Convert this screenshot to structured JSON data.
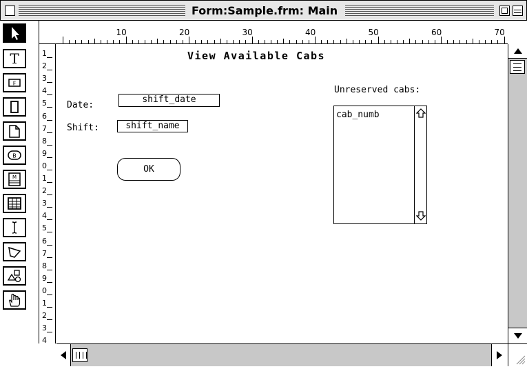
{
  "window": {
    "title": "Form:Sample.frm: Main"
  },
  "toolbar": {
    "tools": [
      {
        "icon": "arrow-pointer-icon",
        "selected": true
      },
      {
        "icon": "text-tool-icon",
        "glyph": "T"
      },
      {
        "icon": "field-tool-icon",
        "glyph": "F"
      },
      {
        "icon": "rectangle-tool-icon"
      },
      {
        "icon": "page-tool-icon"
      },
      {
        "icon": "button-tool-icon",
        "glyph": "B"
      },
      {
        "icon": "menu-tool-icon",
        "glyph": "M"
      },
      {
        "icon": "table-tool-icon"
      },
      {
        "icon": "ibeam-tool-icon"
      },
      {
        "icon": "polygon-tool-icon"
      },
      {
        "icon": "shapes-tool-icon"
      },
      {
        "icon": "hand-tool-icon"
      }
    ]
  },
  "ruler": {
    "horizontal_labels": [
      "10",
      "20",
      "30",
      "40",
      "50",
      "60",
      "70"
    ],
    "vertical_labels": [
      "1",
      "2",
      "3",
      "4",
      "5",
      "6",
      "7",
      "8",
      "9",
      "0",
      "1",
      "2",
      "3",
      "4",
      "5",
      "6",
      "7",
      "8",
      "9",
      "0",
      "1",
      "2",
      "3",
      "4"
    ]
  },
  "form": {
    "title": "View Available Cabs",
    "date_label": "Date:",
    "date_field": "shift_date",
    "shift_label": "Shift:",
    "shift_field": "shift_name",
    "ok_button": "OK",
    "unreserved_label": "Unreserved cabs:",
    "cab_list_item": "cab_numb"
  },
  "colors": {
    "titlebar_bg": "#e6e6e6",
    "scroll_track": "#c8c8c8"
  }
}
